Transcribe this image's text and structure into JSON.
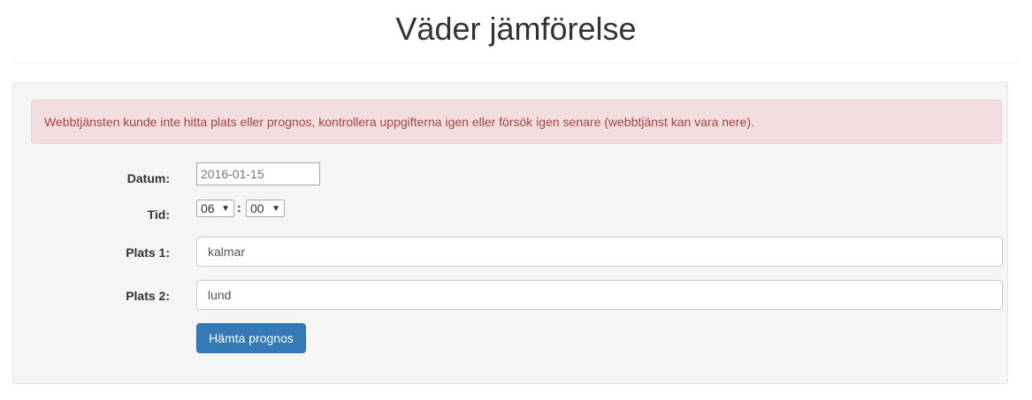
{
  "title": "Väder jämförelse",
  "alert": "Webbtjänsten kunde inte hitta plats eller prognos, kontrollera uppgifterna igen eller försök igen senare (webbtjänst kan vara nere).",
  "form": {
    "date_label": "Datum:",
    "date_value": "2016-01-15",
    "time_label": "Tid:",
    "hour": "06",
    "minute": "00",
    "separator": ":",
    "place1_label": "Plats 1:",
    "place1_value": "kalmar",
    "place2_label": "Plats 2:",
    "place2_value": "lund",
    "submit": "Hämta prognos"
  }
}
